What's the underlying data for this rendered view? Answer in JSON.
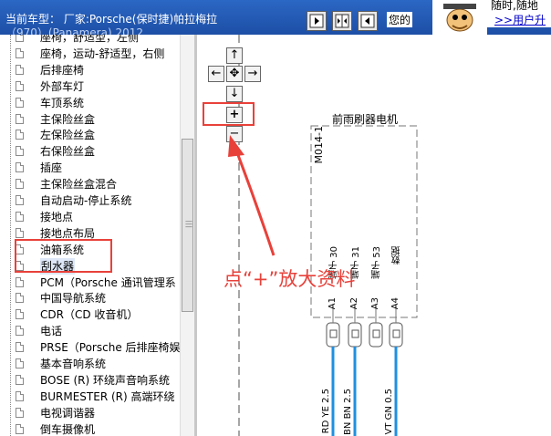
{
  "header": {
    "title": "当前车型： 厂家:Porsche(保时捷)帕拉梅拉",
    "subtitle": "（970）(Panamera) 2012",
    "notice_text": "您的",
    "right_top_text": "随时,随地",
    "right_link": ">>用户升"
  },
  "tree": {
    "items": [
      {
        "label": "座椅，舒适型，左侧"
      },
      {
        "label": "座椅，运动-舒适型，右侧"
      },
      {
        "label": "后排座椅"
      },
      {
        "label": "外部车灯"
      },
      {
        "label": "车顶系统"
      },
      {
        "label": "主保险丝盒"
      },
      {
        "label": "左保险丝盒"
      },
      {
        "label": "右保险丝盒"
      },
      {
        "label": "插座"
      },
      {
        "label": "主保险丝盒混合"
      },
      {
        "label": "自动启动-停止系统"
      },
      {
        "label": "接地点"
      },
      {
        "label": "接地点布局"
      },
      {
        "label": "油箱系统"
      },
      {
        "label": "刮水器"
      },
      {
        "label": "PCM（Porsche 通讯管理系"
      },
      {
        "label": "中国导航系统"
      },
      {
        "label": "CDR（CD 收音机）"
      },
      {
        "label": "电话"
      },
      {
        "label": "PRSE（Porsche 后排座椅娱"
      },
      {
        "label": "基本音响系统"
      },
      {
        "label": "BOSE (R) 环绕声音响系统"
      },
      {
        "label": "BURMESTER (R) 高端环绕"
      },
      {
        "label": "电视调谐器"
      },
      {
        "label": "倒车摄像机"
      }
    ]
  },
  "diagram": {
    "nav": {
      "up": "↑",
      "left": "←",
      "center": "✥",
      "right": "→",
      "down": "↓",
      "zoom_in": "+",
      "zoom_out": "−"
    },
    "component_title": "前雨刷器电机",
    "component_code": "M014-1",
    "terminal_labels": [
      "端子 30",
      "端子 31",
      "端子 53",
      "数据"
    ],
    "pins": [
      "A1",
      "A2",
      "A3",
      "A4"
    ],
    "wire_labels": [
      "RD YE 2.5",
      "BN BN 2.5",
      "",
      "VT GN 0.5"
    ]
  },
  "annotation": {
    "text": "点“+”放大资料"
  },
  "colors": {
    "header_blue": "#1d4fa6",
    "annotation_red": "#e8413a",
    "wire_blue": "#1f8fe0"
  }
}
